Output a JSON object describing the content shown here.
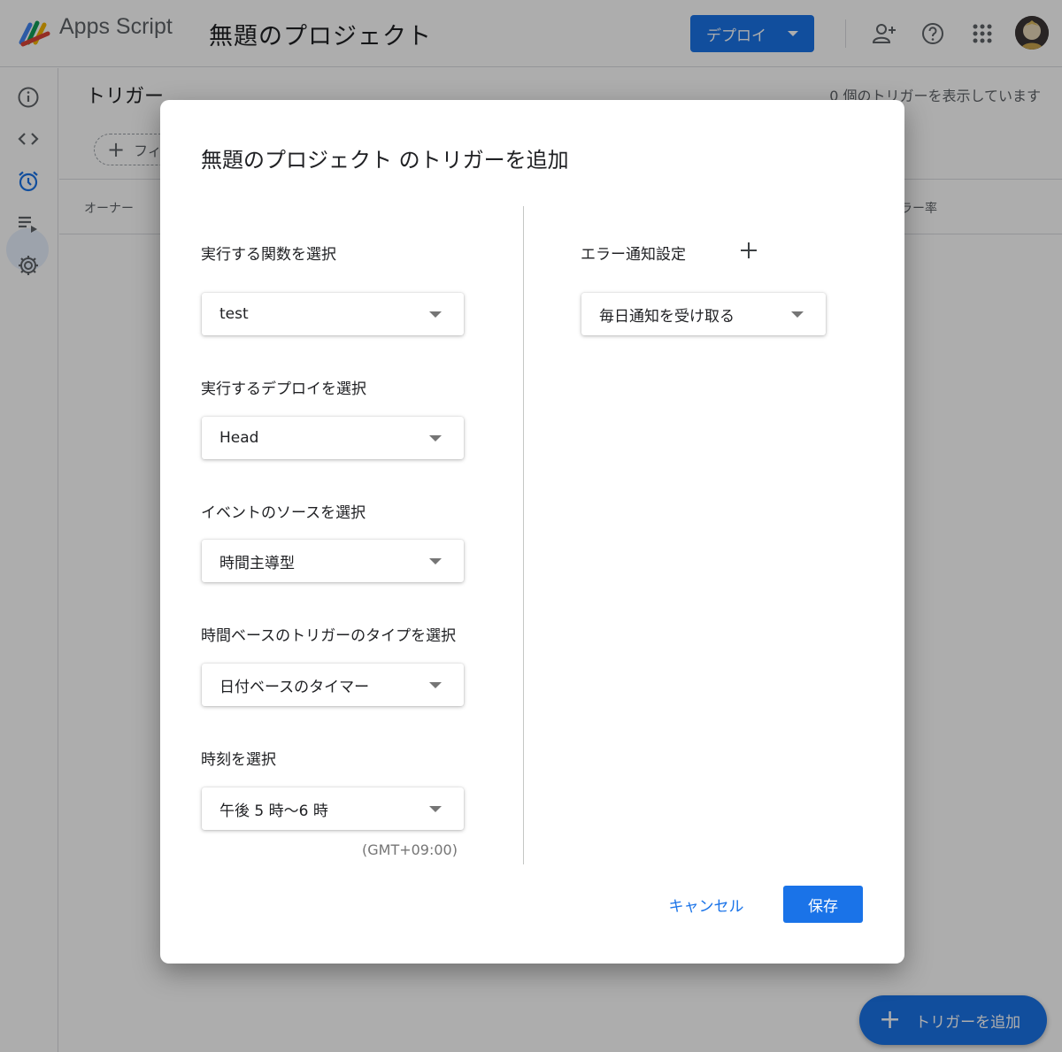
{
  "app": {
    "name": "Apps Script",
    "project_title": "無題のプロジェクト",
    "deploy_label": "デプロイ"
  },
  "page": {
    "title": "トリガー",
    "count_text": "0 個のトリガーを表示しています",
    "filter_label": "フィ",
    "columns": {
      "owner": "オーナー",
      "error_rate": "ラー率"
    },
    "fab_label": "トリガーを追加"
  },
  "dialog": {
    "title": "無題のプロジェクト のトリガーを追加",
    "fields": [
      {
        "label": "実行する関数を選択",
        "value": "test"
      },
      {
        "label": "実行するデプロイを選択",
        "value": "Head"
      },
      {
        "label": "イベントのソースを選択",
        "value": "時間主導型"
      },
      {
        "label": "時間ベースのトリガーのタイプを選択",
        "value": "日付ベースのタイマー"
      },
      {
        "label": "時刻を選択",
        "value": "午後 5 時～6 時"
      }
    ],
    "timezone_note": "(GMT+09:00)",
    "notification": {
      "label": "エラー通知設定",
      "value": "毎日通知を受け取る"
    },
    "cancel_label": "キャンセル",
    "save_label": "保存"
  },
  "colors": {
    "accent": "#1a73e8",
    "scrim": "rgba(0,0,0,0.32)"
  }
}
